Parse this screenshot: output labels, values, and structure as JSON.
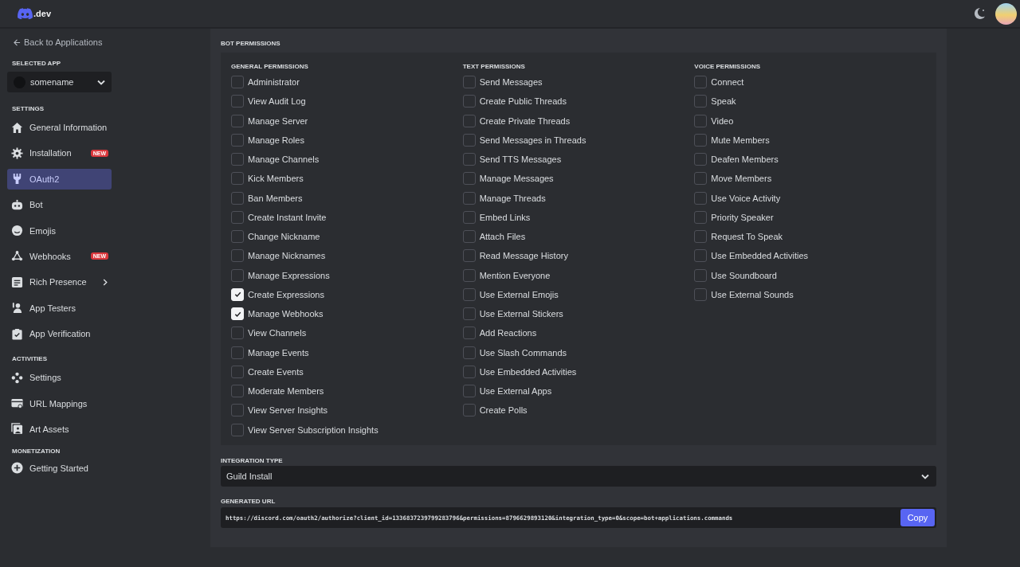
{
  "topbar": {
    "logo_text": ".dev"
  },
  "sidebar": {
    "back_link": "Back to Applications",
    "selected_app_label": "SELECTED APP",
    "app_name": "somename",
    "sections": [
      {
        "title": "SETTINGS",
        "items": [
          {
            "label": "General Information",
            "selected": false
          },
          {
            "label": "Installation",
            "selected": false,
            "badge": "NEW"
          },
          {
            "label": "OAuth2",
            "selected": true
          },
          {
            "label": "Bot",
            "selected": false
          },
          {
            "label": "Emojis",
            "selected": false
          },
          {
            "label": "Webhooks",
            "selected": false,
            "badge": "NEW"
          },
          {
            "label": "Rich Presence",
            "selected": false,
            "expandable": true
          },
          {
            "label": "App Testers",
            "selected": false
          },
          {
            "label": "App Verification",
            "selected": false
          }
        ]
      },
      {
        "title": "ACTIVITIES",
        "items": [
          {
            "label": "Settings",
            "selected": false
          },
          {
            "label": "URL Mappings",
            "selected": false
          },
          {
            "label": "Art Assets",
            "selected": false
          }
        ]
      },
      {
        "title": "MONETIZATION",
        "items": [
          {
            "label": "Getting Started",
            "selected": false
          }
        ]
      }
    ]
  },
  "bot_permissions": {
    "title": "BOT PERMISSIONS",
    "groups": [
      {
        "title": "GENERAL PERMISSIONS",
        "items": [
          {
            "label": "Administrator",
            "checked": false
          },
          {
            "label": "View Audit Log",
            "checked": false
          },
          {
            "label": "Manage Server",
            "checked": false
          },
          {
            "label": "Manage Roles",
            "checked": false
          },
          {
            "label": "Manage Channels",
            "checked": false
          },
          {
            "label": "Kick Members",
            "checked": false
          },
          {
            "label": "Ban Members",
            "checked": false
          },
          {
            "label": "Create Instant Invite",
            "checked": false
          },
          {
            "label": "Change Nickname",
            "checked": false
          },
          {
            "label": "Manage Nicknames",
            "checked": false
          },
          {
            "label": "Manage Expressions",
            "checked": false
          },
          {
            "label": "Create Expressions",
            "checked": true
          },
          {
            "label": "Manage Webhooks",
            "checked": true
          },
          {
            "label": "View Channels",
            "checked": false
          },
          {
            "label": "Manage Events",
            "checked": false
          },
          {
            "label": "Create Events",
            "checked": false
          },
          {
            "label": "Moderate Members",
            "checked": false
          },
          {
            "label": "View Server Insights",
            "checked": false
          },
          {
            "label": "View Server Subscription Insights",
            "checked": false
          }
        ]
      },
      {
        "title": "TEXT PERMISSIONS",
        "items": [
          {
            "label": "Send Messages",
            "checked": false
          },
          {
            "label": "Create Public Threads",
            "checked": false
          },
          {
            "label": "Create Private Threads",
            "checked": false
          },
          {
            "label": "Send Messages in Threads",
            "checked": false
          },
          {
            "label": "Send TTS Messages",
            "checked": false
          },
          {
            "label": "Manage Messages",
            "checked": false
          },
          {
            "label": "Manage Threads",
            "checked": false
          },
          {
            "label": "Embed Links",
            "checked": false
          },
          {
            "label": "Attach Files",
            "checked": false
          },
          {
            "label": "Read Message History",
            "checked": false
          },
          {
            "label": "Mention Everyone",
            "checked": false
          },
          {
            "label": "Use External Emojis",
            "checked": false
          },
          {
            "label": "Use External Stickers",
            "checked": false
          },
          {
            "label": "Add Reactions",
            "checked": false
          },
          {
            "label": "Use Slash Commands",
            "checked": false
          },
          {
            "label": "Use Embedded Activities",
            "checked": false
          },
          {
            "label": "Use External Apps",
            "checked": false
          },
          {
            "label": "Create Polls",
            "checked": false
          }
        ]
      },
      {
        "title": "VOICE PERMISSIONS",
        "items": [
          {
            "label": "Connect",
            "checked": false
          },
          {
            "label": "Speak",
            "checked": false
          },
          {
            "label": "Video",
            "checked": false
          },
          {
            "label": "Mute Members",
            "checked": false
          },
          {
            "label": "Deafen Members",
            "checked": false
          },
          {
            "label": "Move Members",
            "checked": false
          },
          {
            "label": "Use Voice Activity",
            "checked": false
          },
          {
            "label": "Priority Speaker",
            "checked": false
          },
          {
            "label": "Request To Speak",
            "checked": false
          },
          {
            "label": "Use Embedded Activities",
            "checked": false
          },
          {
            "label": "Use Soundboard",
            "checked": false
          },
          {
            "label": "Use External Sounds",
            "checked": false
          }
        ]
      }
    ]
  },
  "integration_type": {
    "label": "INTEGRATION TYPE",
    "value": "Guild Install"
  },
  "generated_url": {
    "label": "GENERATED URL",
    "value": "https://discord.com/oauth2/authorize?client_id=1336837239799283796&permissions=8796629893120&integration_type=0&scope=bot+applications.commands",
    "button": "Copy"
  }
}
